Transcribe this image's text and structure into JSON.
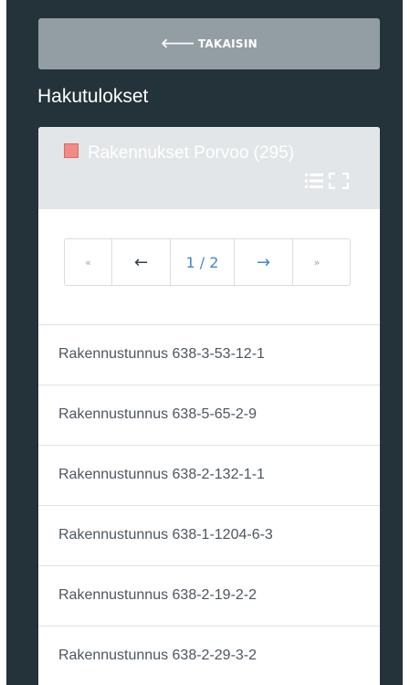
{
  "back_button": {
    "label": "TAKAISIN",
    "icon": "arrow-left-icon"
  },
  "section_title": "Hakutulokset",
  "layer": {
    "title": "Rakennukset Porvoo (295)",
    "swatch_color": "#f28b86",
    "icons": [
      "list-icon",
      "expand-icon"
    ]
  },
  "pagination": {
    "first": "«",
    "prev": "←",
    "current": "1 / 2",
    "next": "→",
    "last": "»"
  },
  "results": [
    "Rakennustunnus 638-3-53-12-1",
    "Rakennustunnus 638-5-65-2-9",
    "Rakennustunnus 638-2-132-1-1",
    "Rakennustunnus 638-1-1204-6-3",
    "Rakennustunnus 638-2-19-2-2",
    "Rakennustunnus 638-2-29-3-2"
  ],
  "colors": {
    "panel_bg": "#24323a",
    "button_bg": "#939ea4",
    "header_bg": "#e3e6e8",
    "link": "#3f89c9"
  }
}
